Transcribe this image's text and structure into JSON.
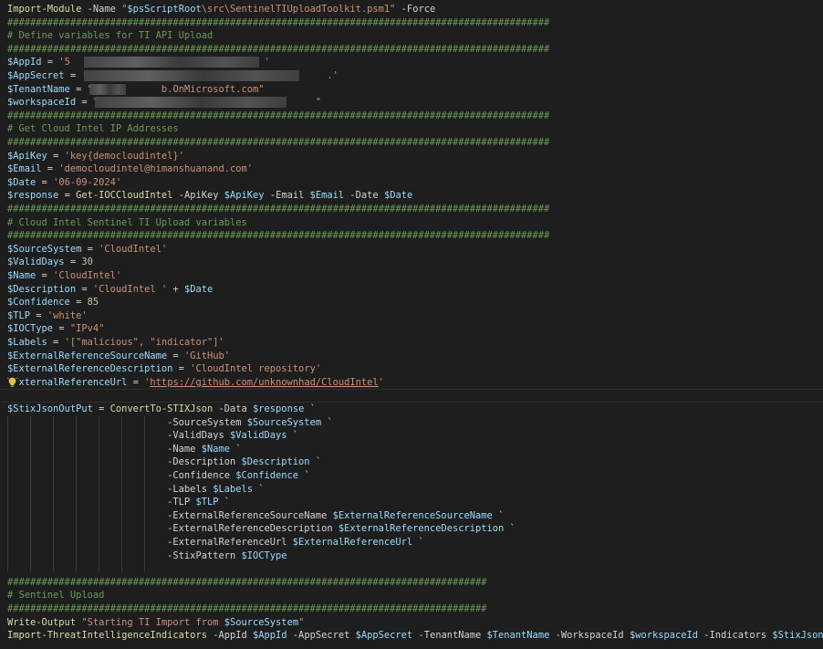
{
  "editor": {
    "colors": {
      "background": "#1e1e1e",
      "command": "#dcdcaa",
      "variable": "#9cdcfe",
      "string": "#ce9178",
      "number": "#b5cea8",
      "comment": "#6a9955",
      "text": "#d4d4d4"
    },
    "lines": [
      [
        [
          "cmd",
          "Import-Module"
        ],
        [
          "sp",
          " -Name "
        ],
        [
          "str",
          "\""
        ],
        [
          "var",
          "$psScriptRoot"
        ],
        [
          "str",
          "\\src\\SentinelTIUploadToolkit.psm1\""
        ],
        [
          "sp",
          " -Force"
        ]
      ],
      [
        [
          "com",
          "###############################################################################################"
        ]
      ],
      [
        [
          "com",
          "# Define variables for TI API Upload"
        ]
      ],
      [
        [
          "com",
          "###############################################################################################"
        ]
      ],
      [
        [
          "var",
          "$AppId"
        ],
        [
          "op",
          " = "
        ],
        [
          "str",
          "'5"
        ],
        [
          "str",
          "                                  "
        ],
        [
          "str",
          "'"
        ]
      ],
      [
        [
          "var",
          "$AppSecret"
        ],
        [
          "op",
          " = "
        ],
        [
          "str",
          "'"
        ],
        [
          "str",
          "                                          "
        ],
        [
          "str",
          ".'"
        ]
      ],
      [
        [
          "var",
          "$TenantName"
        ],
        [
          "op",
          " = "
        ],
        [
          "str",
          "\"            b.OnMicrosoft.com\""
        ]
      ],
      [
        [
          "var",
          "$workspaceId"
        ],
        [
          "op",
          " = "
        ],
        [
          "str",
          "\""
        ],
        [
          "str",
          "                                      "
        ],
        [
          "str",
          "\""
        ]
      ],
      [
        [
          "com",
          "###############################################################################################"
        ]
      ],
      [
        [
          "com",
          "# Get Cloud Intel IP Addresses"
        ]
      ],
      [
        [
          "com",
          "###############################################################################################"
        ]
      ],
      [
        [
          "var",
          "$ApiKey"
        ],
        [
          "op",
          " = "
        ],
        [
          "str",
          "'key{democloudintel}'"
        ]
      ],
      [
        [
          "var",
          "$Email"
        ],
        [
          "op",
          " = "
        ],
        [
          "str",
          "'democloudintel@himanshuanand.com'"
        ]
      ],
      [
        [
          "var",
          "$Date"
        ],
        [
          "op",
          " = "
        ],
        [
          "str",
          "'06-09-2024'"
        ]
      ],
      [
        [
          "var",
          "$response"
        ],
        [
          "op",
          " = "
        ],
        [
          "cmd",
          "Get-IOCCloudIntel"
        ],
        [
          "sp",
          " -ApiKey "
        ],
        [
          "var",
          "$ApiKey"
        ],
        [
          "sp",
          " -Email "
        ],
        [
          "var",
          "$Email"
        ],
        [
          "sp",
          " -Date "
        ],
        [
          "var",
          "$Date"
        ]
      ],
      [
        [
          "com",
          "###############################################################################################"
        ]
      ],
      [
        [
          "com",
          "# Cloud Intel Sentinel TI Upload variables"
        ]
      ],
      [
        [
          "com",
          "###############################################################################################"
        ]
      ],
      [
        [
          "var",
          "$SourceSystem"
        ],
        [
          "op",
          " = "
        ],
        [
          "str",
          "'CloudIntel'"
        ]
      ],
      [
        [
          "var",
          "$ValidDays"
        ],
        [
          "op",
          " = "
        ],
        [
          "num",
          "30"
        ]
      ],
      [
        [
          "var",
          "$Name"
        ],
        [
          "op",
          " = "
        ],
        [
          "str",
          "'CloudIntel'"
        ]
      ],
      [
        [
          "var",
          "$Description"
        ],
        [
          "op",
          " = "
        ],
        [
          "str",
          "'CloudIntel '"
        ],
        [
          "op",
          " + "
        ],
        [
          "var",
          "$Date"
        ]
      ],
      [
        [
          "var",
          "$Confidence"
        ],
        [
          "op",
          " = "
        ],
        [
          "num",
          "85"
        ]
      ],
      [
        [
          "var",
          "$TLP"
        ],
        [
          "op",
          " = "
        ],
        [
          "str",
          "'white'"
        ]
      ],
      [
        [
          "var",
          "$IOCType"
        ],
        [
          "op",
          " = "
        ],
        [
          "str",
          "\"IPv4\""
        ]
      ],
      [
        [
          "var",
          "$Labels"
        ],
        [
          "op",
          " = "
        ],
        [
          "str",
          "'[\"malicious\", \"indicator\"]'"
        ]
      ],
      [
        [
          "var",
          "$ExternalReferenceSourceName"
        ],
        [
          "op",
          " = "
        ],
        [
          "str",
          "'GitHub'"
        ]
      ],
      [
        [
          "var",
          "$ExternalReferenceDescription"
        ],
        [
          "op",
          " = "
        ],
        [
          "str",
          "'CloudIntel repository'"
        ]
      ],
      [
        [
          "var",
          "  xternalReferenceUrl"
        ],
        [
          "op",
          " = "
        ],
        [
          "str",
          "'"
        ],
        [
          "url",
          "https://github.com/unknownhad/CloudIntel"
        ],
        [
          "str",
          "'"
        ]
      ],
      [],
      [
        [
          "var",
          "$StixJsonOutPut"
        ],
        [
          "op",
          " = "
        ],
        [
          "cmd",
          "ConvertTo-STIXJson"
        ],
        [
          "sp",
          " -Data "
        ],
        [
          "var",
          "$response"
        ],
        [
          "sp",
          " `"
        ]
      ],
      [
        [
          "sp",
          "                            -SourceSystem "
        ],
        [
          "var",
          "$SourceSystem"
        ],
        [
          "sp",
          " `"
        ]
      ],
      [
        [
          "sp",
          "                            -ValidDays "
        ],
        [
          "var",
          "$ValidDays"
        ],
        [
          "sp",
          " `"
        ]
      ],
      [
        [
          "sp",
          "                            -Name "
        ],
        [
          "var",
          "$Name"
        ],
        [
          "sp",
          " `"
        ]
      ],
      [
        [
          "sp",
          "                            -Description "
        ],
        [
          "var",
          "$Description"
        ],
        [
          "sp",
          " `"
        ]
      ],
      [
        [
          "sp",
          "                            -Confidence "
        ],
        [
          "var",
          "$Confidence"
        ],
        [
          "sp",
          " `"
        ]
      ],
      [
        [
          "sp",
          "                            -Labels "
        ],
        [
          "var",
          "$Labels"
        ],
        [
          "sp",
          " `"
        ]
      ],
      [
        [
          "sp",
          "                            -TLP "
        ],
        [
          "var",
          "$TLP"
        ],
        [
          "sp",
          " `"
        ]
      ],
      [
        [
          "sp",
          "                            -ExternalReferenceSourceName "
        ],
        [
          "var",
          "$ExternalReferenceSourceName"
        ],
        [
          "sp",
          " `"
        ]
      ],
      [
        [
          "sp",
          "                            -ExternalReferenceDescription "
        ],
        [
          "var",
          "$ExternalReferenceDescription"
        ],
        [
          "sp",
          " `"
        ]
      ],
      [
        [
          "sp",
          "                            -ExternalReferenceUrl "
        ],
        [
          "var",
          "$ExternalReferenceUrl"
        ],
        [
          "sp",
          " `"
        ]
      ],
      [
        [
          "sp",
          "                            -StixPattern "
        ],
        [
          "var",
          "$IOCType"
        ]
      ],
      [],
      [
        [
          "com",
          "####################################################################################"
        ]
      ],
      [
        [
          "com",
          "# Sentinel Upload"
        ]
      ],
      [
        [
          "com",
          "####################################################################################"
        ]
      ],
      [
        [
          "cmd",
          "Write-Output"
        ],
        [
          "sp",
          " "
        ],
        [
          "str",
          "\"Starting TI Import from "
        ],
        [
          "var",
          "$SourceSystem"
        ],
        [
          "str",
          "\""
        ]
      ],
      [
        [
          "cmd",
          "Import-ThreatIntelligenceIndicators"
        ],
        [
          "sp",
          " -AppId "
        ],
        [
          "var",
          "$AppId"
        ],
        [
          "sp",
          " -AppSecret "
        ],
        [
          "var",
          "$AppSecret"
        ],
        [
          "sp",
          " -TenantName "
        ],
        [
          "var",
          "$TenantName"
        ],
        [
          "sp",
          " -WorkspaceId "
        ],
        [
          "var",
          "$workspaceId"
        ],
        [
          "sp",
          " -Indicators "
        ],
        [
          "var",
          "$StixJsonOutPut"
        ]
      ]
    ],
    "lightbulb_icon": "lightbulb-icon"
  }
}
